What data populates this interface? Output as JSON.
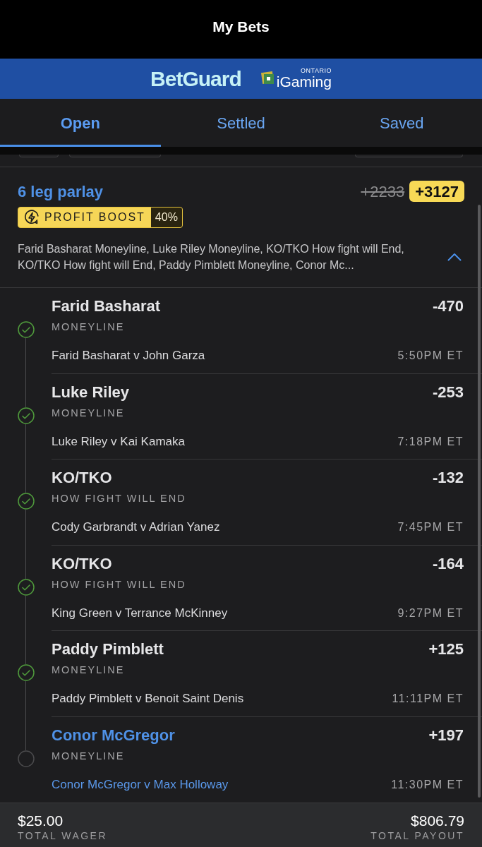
{
  "header": {
    "title": "My Bets"
  },
  "banner": {
    "brand": "BetGuard",
    "partner": {
      "name": "iGaming",
      "region": "ONTARIO"
    }
  },
  "tabs": [
    {
      "label": "Open",
      "selected": true
    },
    {
      "label": "Settled",
      "selected": false
    },
    {
      "label": "Saved",
      "selected": false
    }
  ],
  "bet": {
    "title": "6 leg parlay",
    "original_odds": "+2233",
    "boosted_odds": "+3127",
    "boost": {
      "label": "PROFIT BOOST",
      "percent": "40%"
    },
    "summary": "Farid Basharat Moneyline, Luke Riley Moneyline, KO/TKO How fight will End, KO/TKO How fight will End, Paddy Pimblett Moneyline, Conor Mc...",
    "expanded": true,
    "legs": [
      {
        "selection": "Farid Basharat",
        "market": "MONEYLINE",
        "odds": "-470",
        "matchup": "Farid Basharat v John Garza",
        "time": "5:50PM ET",
        "won": true
      },
      {
        "selection": "Luke Riley",
        "market": "MONEYLINE",
        "odds": "-253",
        "matchup": "Luke Riley v Kai Kamaka",
        "time": "7:18PM ET",
        "won": true
      },
      {
        "selection": "KO/TKO",
        "market": "HOW FIGHT WILL END",
        "odds": "-132",
        "matchup": "Cody Garbrandt v Adrian Yanez",
        "time": "7:45PM ET",
        "won": true
      },
      {
        "selection": "KO/TKO",
        "market": "HOW FIGHT WILL END",
        "odds": "-164",
        "matchup": "King Green v Terrance McKinney",
        "time": "9:27PM ET",
        "won": true
      },
      {
        "selection": "Paddy Pimblett",
        "market": "MONEYLINE",
        "odds": "+125",
        "matchup": "Paddy Pimblett v Benoit Saint Denis",
        "time": "11:11PM ET",
        "won": true
      },
      {
        "selection": "Conor McGregor",
        "market": "MONEYLINE",
        "odds": "+197",
        "matchup": "Conor McGregor v Max Holloway",
        "time": "11:30PM ET",
        "won": false
      }
    ]
  },
  "footer": {
    "wager": {
      "amount": "$25.00",
      "label": "TOTAL WAGER"
    },
    "payout": {
      "amount": "$806.79",
      "label": "TOTAL PAYOUT"
    }
  }
}
